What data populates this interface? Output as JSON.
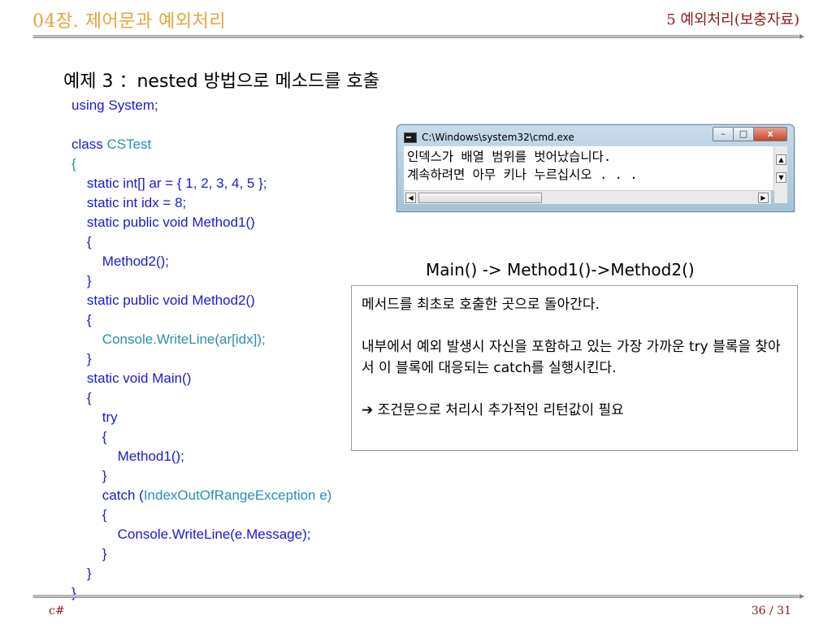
{
  "header": {
    "chapter": "04장. 제어문과 예외처리",
    "section": "5 예외처리(보충자료)"
  },
  "subtitle": "예제 3 ：nested 방법으로 메소드를 호출",
  "code_lines": [
    "using System;",
    "",
    "class CSTest",
    "{",
    "    static int[] ar = { 1, 2, 3, 4, 5 };",
    "    static int idx = 8;",
    "    static public void Method1()",
    "    {",
    "        Method2();",
    "    }",
    "    static public void Method2()",
    "    {",
    "        Console.WriteLine(ar[idx]);",
    "    }",
    "    static void Main()",
    "    {",
    "        try",
    "        {",
    "            Method1();",
    "        }",
    "        catch (IndexOutOfRangeException e)",
    "        {",
    "            Console.WriteLine(e.Message);",
    "        }",
    "    }",
    "}"
  ],
  "console": {
    "title": "C:\\Windows\\system32\\cmd.exe",
    "lines": [
      "인덱스가 배열 범위를 벗어났습니다.",
      "계속하려면 아무 키나 누르십시오 . . ."
    ],
    "buttons": {
      "minimize": "–",
      "maximize": "□",
      "close": "x"
    }
  },
  "flow": "Main() -> Method1()->Method2()",
  "note": {
    "line1": "메서드를 최초로 호출한  곳으로 돌아간다.",
    "para2": "내부에서 예외 발생시 자신을 포함하고 있는 가장 가까운 try 블록을 찾아서 이 블록에 대응되는 catch를 실행시킨다.",
    "arrow": "➔",
    "line3": "조건문으로 처리시 추가적인 리턴값이 필요"
  },
  "footer": {
    "left": "c#",
    "right": "36 / 31"
  },
  "colors": {
    "chapter": "#e8a33a",
    "section": "#8a1a1a",
    "code": "#1a1ad0",
    "code_highlight": "#2a8fb0"
  }
}
